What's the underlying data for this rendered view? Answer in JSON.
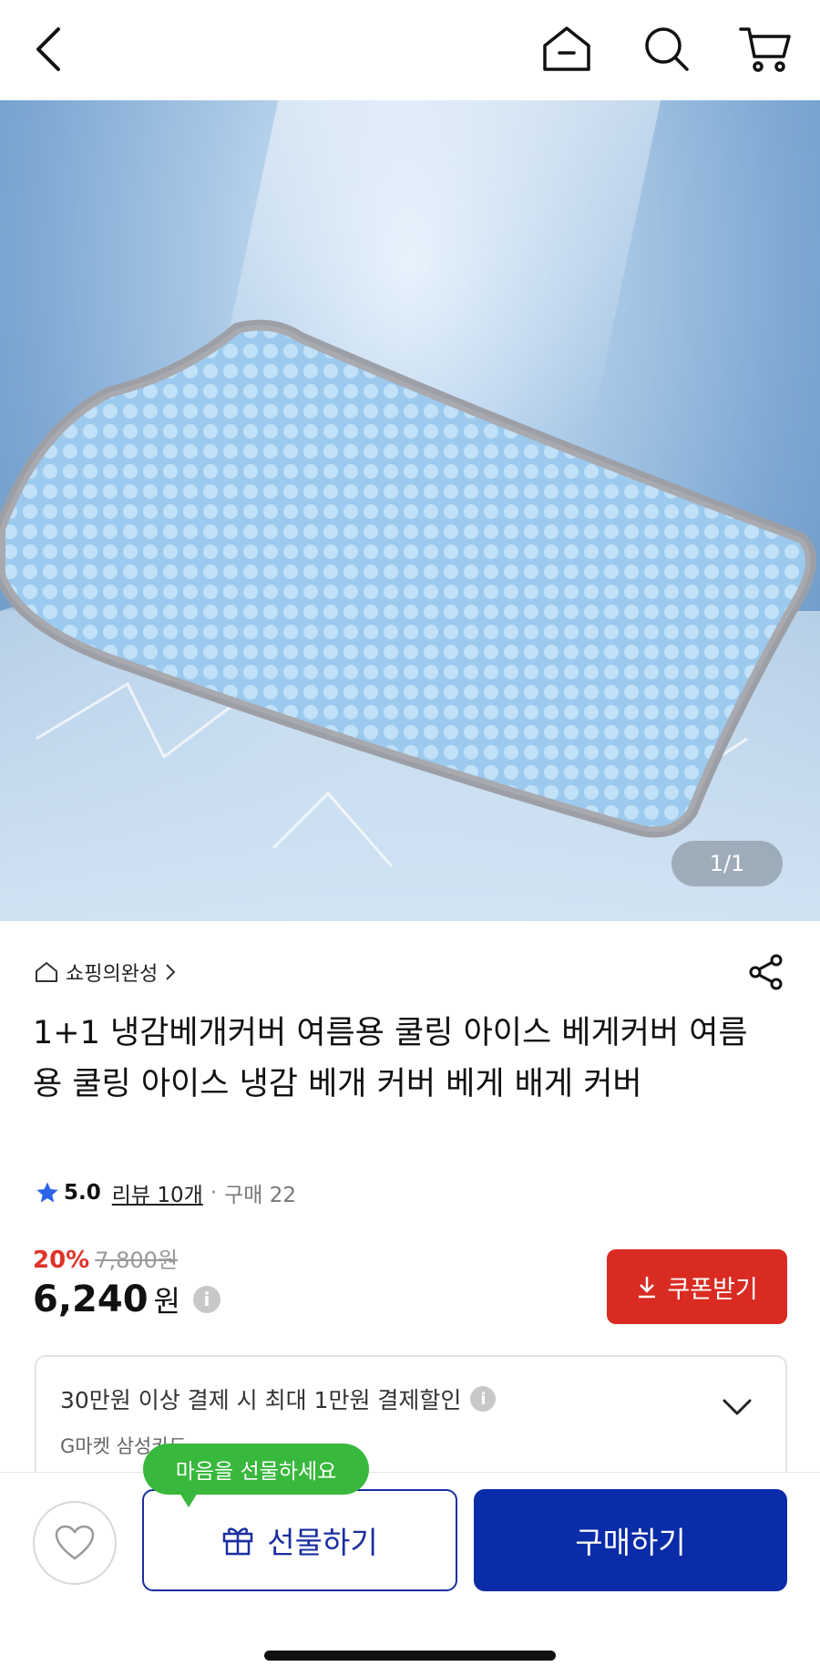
{
  "header": {
    "back_icon": "chevron-left-icon",
    "home_icon": "home-icon",
    "search_icon": "search-icon",
    "cart_icon": "cart-icon"
  },
  "gallery": {
    "counter": "1/1"
  },
  "product": {
    "store_name": "쇼핑의완성",
    "title": "1+1 냉감베개커버  여름용 쿨링 아이스 베게커버 여름용 쿨링 아이스 냉감 베개 커버 베게 배게 커버",
    "rating_score": "5.0",
    "review_label": "리뷰 10개",
    "sales_label": "구매 22",
    "discount_percent": "20%",
    "original_price": "7,800원",
    "price": "6,240",
    "price_unit": "원",
    "info_mark": "i",
    "coupon_label": "쿠폰받기"
  },
  "card_promo": {
    "text": "30만원 이상 결제 시 최대 1만원 결제할인",
    "card_name": "G마켓 삼성카드"
  },
  "bottom": {
    "tooltip": "마음을 선물하세요",
    "gift_label": "선물하기",
    "buy_label": "구매하기"
  },
  "colors": {
    "accent_red": "#d92b22",
    "brand_blue": "#0a2ca8",
    "tooltip_green": "#38b83c",
    "star_blue": "#2b63e6"
  }
}
